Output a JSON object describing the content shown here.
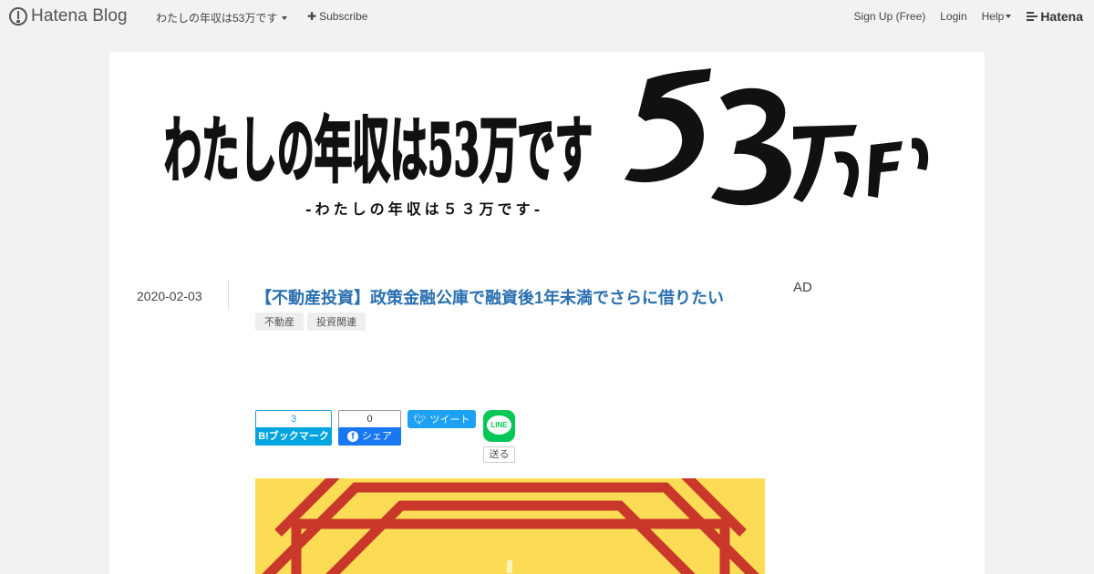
{
  "global_nav": {
    "logo_text": "Hatena Blog",
    "blog_menu_label": "わたしの年収は53万です",
    "subscribe_label": "Subscribe",
    "sign_up_label": "Sign Up (Free)",
    "login_label": "Login",
    "help_label": "Help",
    "hatena_label": "Hatena",
    "icons": {
      "logo": "hatena-blog-logo-icon",
      "subscribe": "plus-icon",
      "dropdown": "caret-down-icon",
      "brand": "hatena-icon"
    }
  },
  "blog_header": {
    "banner_title": "わたしの年収は53万です",
    "banner_subtitle": "-わたしの年収は５３万です-"
  },
  "entry": {
    "date": "2020-02-03",
    "title": "【不動産投資】政策金融公庫で融資後1年未満でさらに借りたい",
    "tags": [
      "不動産",
      "投資関連"
    ]
  },
  "sidebar": {
    "ad_label": "AD"
  },
  "share_buttons": {
    "hatena_bookmark": {
      "count": "3",
      "label": "B!ブックマーク"
    },
    "facebook": {
      "count": "0",
      "label": "シェア"
    },
    "twitter": {
      "label": "ツイート"
    },
    "line": {
      "icon_text": "LINE",
      "send_label": "送る"
    }
  },
  "colors": {
    "title_link": "#2a6fb0",
    "hatena_bookmark": "#00a4de",
    "facebook": "#1877f2",
    "twitter": "#1da1f2",
    "line": "#06c755",
    "eyecatch_background": "#fcdb55",
    "eyecatch_pattern": "#c9382a"
  }
}
